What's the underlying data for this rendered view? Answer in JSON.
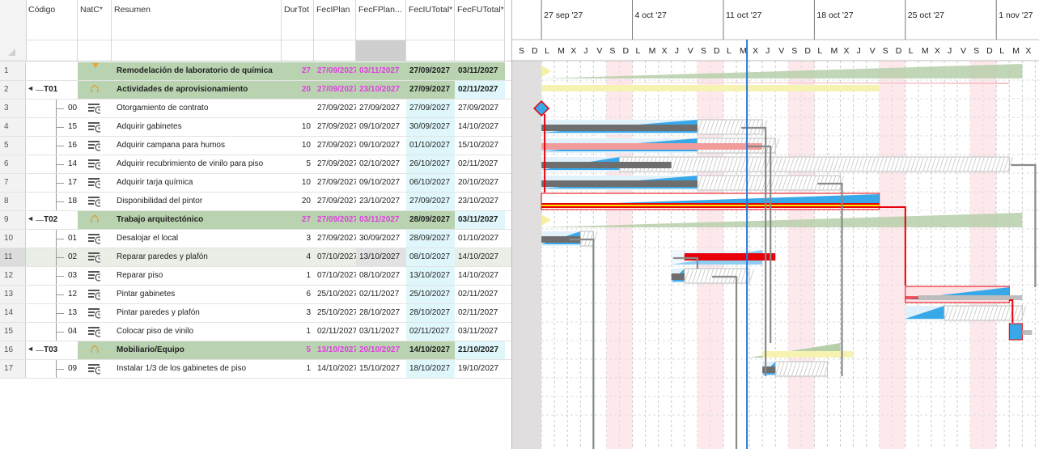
{
  "columns": {
    "codigo": "Código",
    "natc": "NatC*",
    "resumen": "Resumen",
    "durtot": "DurTot",
    "fecplan": "FecIPlan",
    "fecfplan": "FecFPlan...",
    "feciutotal": "FecIUTotal*",
    "fecfutotal": "FecFUTotal*"
  },
  "timeline": {
    "weeks": [
      "27 sep '27",
      "4 oct '27",
      "11 oct '27",
      "18 oct '27",
      "25 oct '27",
      "1 nov '27"
    ],
    "day_letters": [
      "S",
      "D",
      "L",
      "M",
      "X",
      "J",
      "V",
      "S",
      "D",
      "L",
      "M",
      "X",
      "J",
      "V",
      "S",
      "D",
      "L",
      "M",
      "X",
      "J",
      "V",
      "S",
      "D",
      "L",
      "M",
      "X",
      "J",
      "V",
      "S",
      "D",
      "L",
      "M",
      "X",
      "J",
      "V",
      "S",
      "D",
      "L",
      "M",
      "X"
    ]
  },
  "rows": [
    {
      "num": "1",
      "code": "",
      "name": "Remodelación de laboratorio de química",
      "dur": "27",
      "fip": "27/09/2027",
      "ffp": "03/11/2027",
      "fiu": "27/09/2027",
      "ffu": "03/11/2027",
      "type": "project"
    },
    {
      "num": "2",
      "code": "T01",
      "name": "Actividades de aprovisionamiento",
      "dur": "20",
      "fip": "27/09/2027",
      "ffp": "23/10/2027",
      "fiu": "27/09/2027",
      "ffu": "02/11/2027",
      "type": "summary"
    },
    {
      "num": "3",
      "code": "00",
      "name": "Otorgamiento de contrato",
      "dur": "",
      "fip": "27/09/2027",
      "ffp": "27/09/2027",
      "fiu": "27/09/2027",
      "ffu": "27/09/2027",
      "type": "task"
    },
    {
      "num": "4",
      "code": "15",
      "name": "Adquirir gabinetes",
      "dur": "10",
      "fip": "27/09/2027",
      "ffp": "09/10/2027",
      "fiu": "30/09/2027",
      "ffu": "14/10/2027",
      "type": "task"
    },
    {
      "num": "5",
      "code": "16",
      "name": "Adquirir campana para humos",
      "dur": "10",
      "fip": "27/09/2027",
      "ffp": "09/10/2027",
      "fiu": "01/10/2027",
      "ffu": "15/10/2027",
      "type": "task"
    },
    {
      "num": "6",
      "code": "14",
      "name": "Adquirir recubrimiento de vinilo para piso",
      "dur": "5",
      "fip": "27/09/2027",
      "ffp": "02/10/2027",
      "fiu": "26/10/2027",
      "ffu": "02/11/2027",
      "type": "task"
    },
    {
      "num": "7",
      "code": "17",
      "name": "Adquirir tarja química",
      "dur": "10",
      "fip": "27/09/2027",
      "ffp": "09/10/2027",
      "fiu": "06/10/2027",
      "ffu": "20/10/2027",
      "type": "task"
    },
    {
      "num": "8",
      "code": "18",
      "name": "Disponibilidad del pintor",
      "dur": "20",
      "fip": "27/09/2027",
      "ffp": "23/10/2027",
      "fiu": "27/09/2027",
      "ffu": "23/10/2027",
      "type": "task"
    },
    {
      "num": "9",
      "code": "T02",
      "name": "Trabajo arquitectónico",
      "dur": "27",
      "fip": "27/09/2027",
      "ffp": "03/11/2027",
      "fiu": "28/09/2027",
      "ffu": "03/11/2027",
      "type": "summary"
    },
    {
      "num": "10",
      "code": "01",
      "name": "Desalojar el local",
      "dur": "3",
      "fip": "27/09/2027",
      "ffp": "30/09/2027",
      "fiu": "28/09/2027",
      "ffu": "01/10/2027",
      "type": "task"
    },
    {
      "num": "11",
      "code": "02",
      "name": "Reparar paredes y plafón",
      "dur": "4",
      "fip": "07/10/2027",
      "ffp": "13/10/2027",
      "fiu": "08/10/2027",
      "ffu": "14/10/2027",
      "type": "task",
      "selected": true
    },
    {
      "num": "12",
      "code": "03",
      "name": "Reparar piso",
      "dur": "1",
      "fip": "07/10/2027",
      "ffp": "08/10/2027",
      "fiu": "13/10/2027",
      "ffu": "14/10/2027",
      "type": "task"
    },
    {
      "num": "13",
      "code": "12",
      "name": "Pintar gabinetes",
      "dur": "6",
      "fip": "25/10/2027",
      "ffp": "02/11/2027",
      "fiu": "25/10/2027",
      "ffu": "02/11/2027",
      "type": "task"
    },
    {
      "num": "14",
      "code": "13",
      "name": "Pintar paredes y plafón",
      "dur": "3",
      "fip": "25/10/2027",
      "ffp": "28/10/2027",
      "fiu": "28/10/2027",
      "ffu": "02/11/2027",
      "type": "task"
    },
    {
      "num": "15",
      "code": "04",
      "name": "Colocar piso de vinilo",
      "dur": "1",
      "fip": "02/11/2027",
      "ffp": "03/11/2027",
      "fiu": "02/11/2027",
      "ffu": "03/11/2027",
      "type": "task"
    },
    {
      "num": "16",
      "code": "T03",
      "name": "Mobiliario/Equipo",
      "dur": "5",
      "fip": "13/10/2027",
      "ffp": "20/10/2027",
      "fiu": "14/10/2027",
      "ffu": "21/10/2027",
      "type": "summary"
    },
    {
      "num": "17",
      "code": "09",
      "name": "Instalar 1/3 de los gabinetes de piso",
      "dur": "1",
      "fip": "14/10/2027",
      "ffp": "15/10/2027",
      "fiu": "18/10/2027",
      "ffu": "19/10/2027",
      "type": "task"
    }
  ],
  "colors": {
    "summary": "#b9d3b0",
    "plan_pink": "#e040e0",
    "cyan": "#dff7fb",
    "critical": "#e8000a",
    "bar_gray": "#6e6e6e",
    "bar_blue": "#39a8e8",
    "today_line": "#2b7ad0"
  }
}
